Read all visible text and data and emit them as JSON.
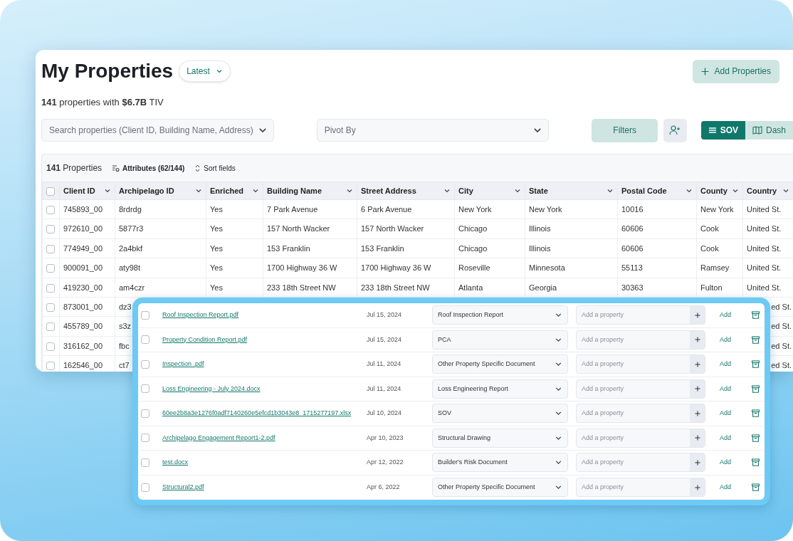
{
  "header": {
    "title": "My Properties",
    "version_menu": "Latest",
    "add_button": "Add Properties"
  },
  "summary": "**141** properties with **$6.7B** TIV",
  "controls": {
    "search_placeholder": "Search properties (Client ID, Building Name, Address)",
    "pivot_placeholder": "Pivot By",
    "filters_button": "Filters",
    "view_toggle": [
      {
        "label": "SOV",
        "selected": true
      },
      {
        "label": "Dash",
        "selected": false
      }
    ]
  },
  "table_toolbar": {
    "count": "**141** Properties",
    "attributes": "Attributes (62/144)",
    "sort": "Sort fields"
  },
  "table": {
    "all_checked": false,
    "columns": [
      {
        "label": "Client ID"
      },
      {
        "label": "Archipelago ID"
      },
      {
        "label": "Enriched"
      },
      {
        "label": "Building Name"
      },
      {
        "label": "Street Address"
      },
      {
        "label": "City"
      },
      {
        "label": "State"
      },
      {
        "label": "Postal Code"
      },
      {
        "label": "County"
      },
      {
        "label": "Country"
      }
    ],
    "rows": [
      {
        "checked": false,
        "cells": [
          "745893_00",
          "8rdrdg",
          "Yes",
          "7 Park Avenue",
          "6 Park Avenue",
          "New York",
          "New York",
          "10016",
          "New York",
          "United St."
        ]
      },
      {
        "checked": false,
        "cells": [
          "972610_00",
          "5877r3",
          "Yes",
          "157 North Wacker",
          "157 North Wacker",
          "Chicago",
          "Illinois",
          "60606",
          "Cook",
          "United St."
        ]
      },
      {
        "checked": false,
        "cells": [
          "774949_00",
          "2a4bkf",
          "Yes",
          "153 Franklin",
          "153 Franklin",
          "Chicago",
          "Illinois",
          "60606",
          "Cook",
          "United St."
        ]
      },
      {
        "checked": false,
        "cells": [
          "900091_00",
          "aty98t",
          "Yes",
          "1700 Highway 36 W",
          "1700 Highway 36 W",
          "Roseville",
          "Minnesota",
          "55113",
          "Ramsey",
          "United St."
        ]
      },
      {
        "checked": false,
        "cells": [
          "419230_00",
          "am4czr",
          "Yes",
          "233 18th Street NW",
          "233 18th Street NW",
          "Atlanta",
          "Georgia",
          "30363",
          "Fulton",
          "United St."
        ]
      },
      {
        "checked": false,
        "kind": "covered",
        "cells": [
          "873001_00",
          "dz3",
          "ed St."
        ]
      },
      {
        "checked": false,
        "kind": "covered",
        "cells": [
          "455789_00",
          "s3z",
          "ed St."
        ]
      },
      {
        "checked": false,
        "kind": "covered",
        "cells": [
          "316162_00",
          "fbc",
          "ed St."
        ]
      },
      {
        "checked": false,
        "kind": "covered",
        "cells": [
          "162546_00",
          "ct7",
          "ed St."
        ]
      }
    ]
  },
  "documents": [
    {
      "checked": false,
      "file": "Roof Inspection Report.pdf",
      "date": "Jul 15, 2024",
      "type": "Roof Inspection Report",
      "property_placeholder": "Add a property",
      "action": "Add"
    },
    {
      "checked": false,
      "file": "Property Condition Report.pdf",
      "date": "Jul 15, 2024",
      "type": "PCA",
      "property_placeholder": "Add a property",
      "action": "Add"
    },
    {
      "checked": false,
      "file": "Inspection .pdf",
      "date": "Jul 11, 2024",
      "type": "Other Property Specific Document",
      "property_placeholder": "Add a property",
      "action": "Add"
    },
    {
      "checked": false,
      "file": "Loss Engineering - July 2024.docx",
      "date": "Jul 11, 2024",
      "type": "Loss Engineering Report",
      "property_placeholder": "Add a property",
      "action": "Add"
    },
    {
      "checked": false,
      "file": "60ee2b8a3e1276f0adf7140260e5efcd1b3043e8_1715277197.xlsx",
      "date": "Jul 10, 2024",
      "type": "SOV",
      "property_placeholder": "Add a property",
      "action": "Add"
    },
    {
      "checked": false,
      "file": "Archipelago Engagement Report1-2.pdf",
      "date": "Apr 10, 2023",
      "type": "Structural Drawing",
      "property_placeholder": "Add a property",
      "action": "Add"
    },
    {
      "checked": false,
      "file": "test.docx",
      "date": "Apr 12, 2022",
      "type": "Builder's Risk Document",
      "property_placeholder": "Add a property",
      "action": "Add"
    },
    {
      "checked": false,
      "file": "Structural2.pdf",
      "date": "Apr 6, 2022",
      "type": "Other Property Specific Document",
      "property_placeholder": "Add a property",
      "action": "Add"
    }
  ]
}
